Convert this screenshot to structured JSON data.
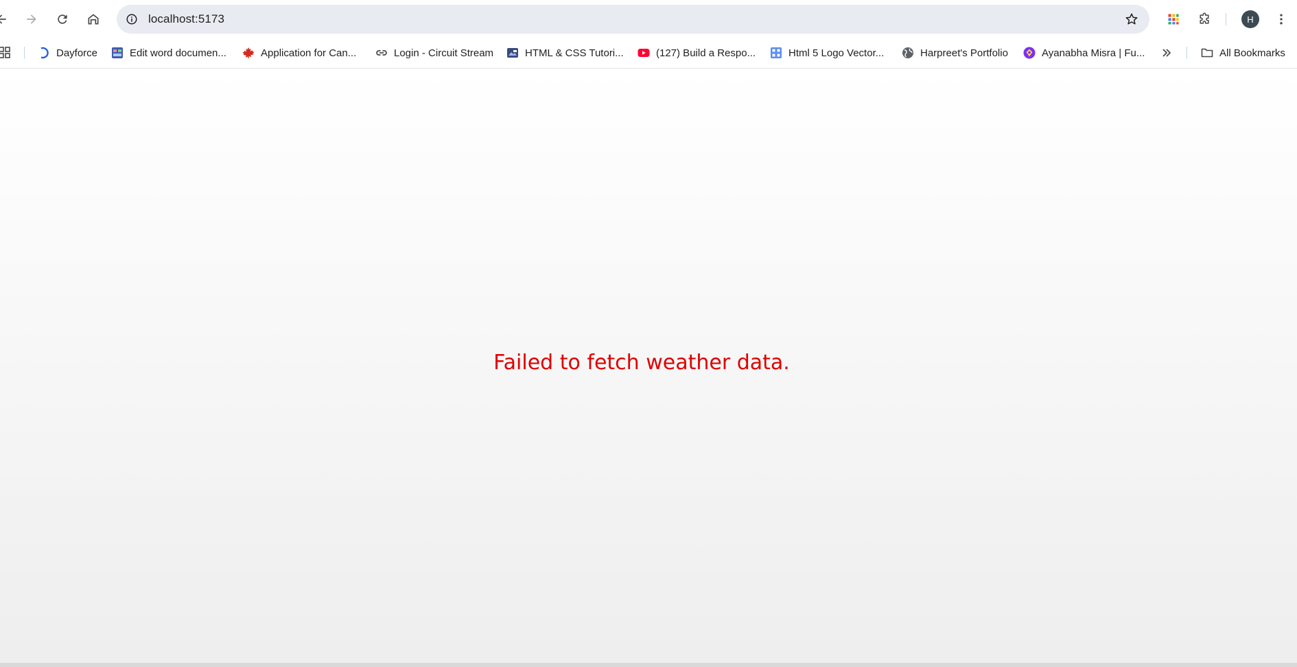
{
  "browser": {
    "url": "localhost:5173",
    "profile_initial": "H",
    "accent_color": "#0b57d0"
  },
  "bookmarks": [
    {
      "label": "Dayforce",
      "icon": "dayforce-icon"
    },
    {
      "label": "Edit word documen...",
      "icon": "word-editor-icon"
    },
    {
      "label": "Application for Can...",
      "icon": "maple-leaf-icon"
    },
    {
      "label": "Login - Circuit Stream",
      "icon": "link-icon"
    },
    {
      "label": "HTML & CSS Tutori...",
      "icon": "tutorial-icon"
    },
    {
      "label": "(127) Build a Respo...",
      "icon": "youtube-icon"
    },
    {
      "label": "Html 5 Logo Vector...",
      "icon": "repo-icon"
    },
    {
      "label": "Harpreet's Portfolio",
      "icon": "globe-icon"
    },
    {
      "label": "Ayanabha Misra | Fu...",
      "icon": "portfolio-icon"
    }
  ],
  "all_bookmarks_label": "All Bookmarks",
  "page": {
    "error_message": "Failed to fetch weather data.",
    "error_color": "#e00000"
  }
}
